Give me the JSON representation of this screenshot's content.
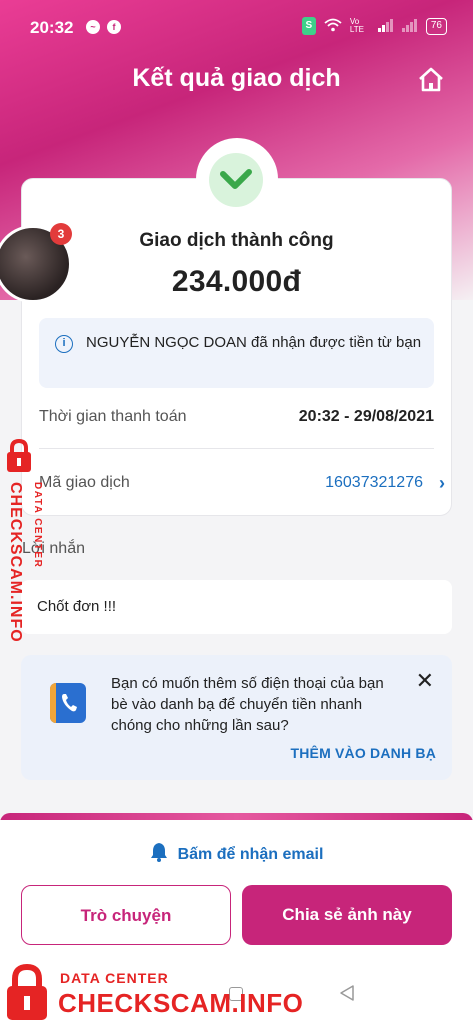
{
  "status_bar": {
    "time": "20:32",
    "app1_icon": "messenger-icon",
    "app2_icon": "facebook-icon",
    "shield_label": "S",
    "volte_label": "Vo LTE",
    "battery": "76"
  },
  "header": {
    "title": "Kết quả giao dịch",
    "home_icon": "home-icon"
  },
  "result": {
    "status": "Giao dịch thành công",
    "amount": "234.000đ",
    "notice": "NGUYỄN NGỌC DOAN đã nhận được tiền từ bạn"
  },
  "details": {
    "time_label": "Thời gian thanh toán",
    "time_value": "20:32 - 29/08/2021",
    "txid_label": "Mã giao dịch",
    "txid_value": "16037321276"
  },
  "message": {
    "label": "Lời nhắn",
    "text": "Chốt đơn !!!"
  },
  "contact_prompt": {
    "text": "Bạn có muốn thêm số điện thoại của bạn bè vào danh bạ để chuyển tiền nhanh chóng cho những lần sau?",
    "action": "THÊM VÀO DANH BẠ",
    "close": "✕"
  },
  "bottom": {
    "email_label": "Bấm để nhận email",
    "chat_button": "Trò chuyện",
    "share_button": "Chia sẻ ảnh này"
  },
  "chat_head": {
    "badge": "3"
  },
  "watermark": {
    "vertical_small": "DATA CENTER",
    "vertical_big": "CHECKSCAM.INFO",
    "bottom_small": "DATA CENTER",
    "bottom_big": "CHECKSCAM.INFO"
  },
  "colors": {
    "brand": "#c7257a",
    "link": "#1c6fbf",
    "success": "#3aa84a",
    "watermark": "#e52424"
  }
}
